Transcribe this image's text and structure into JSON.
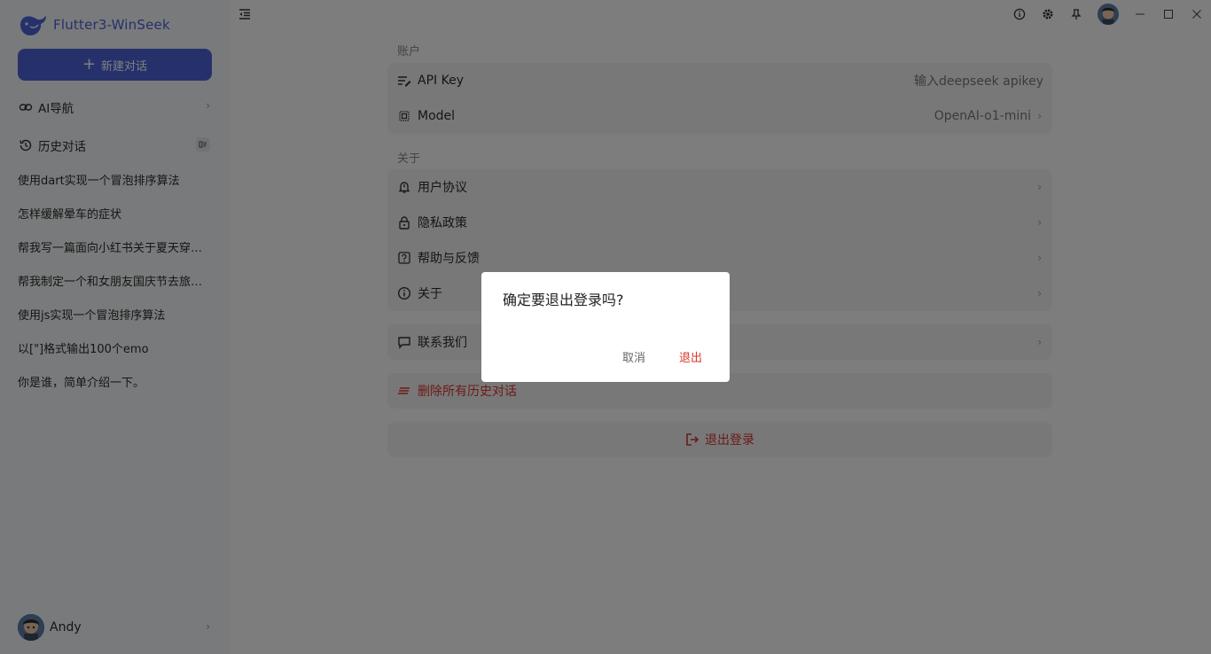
{
  "app": {
    "title": "Flutter3-WinSeek"
  },
  "sidebar": {
    "new_chat_label": "新建对话",
    "nav_ai": "AI导航",
    "nav_history": "历史对话",
    "history": [
      "使用dart实现一个冒泡排序算法",
      "怎样缓解晕车的症状",
      "帮我写一篇面向小红书关于夏天穿搭的文案",
      "帮我制定一个和女朋友国庆节去旅游的攻略",
      "使用js实现一个冒泡排序算法",
      "以[\"]格式输出100个emo",
      "你是谁，简单介绍一下。"
    ],
    "user_name": "Andy"
  },
  "settings": {
    "account_title": "账户",
    "api_key_label": "API Key",
    "api_key_placeholder": "输入deepseek apikey",
    "model_label": "Model",
    "model_value": "OpenAI-o1-mini",
    "about_title": "关于",
    "user_agreement": "用户协议",
    "privacy_policy": "隐私政策",
    "help_feedback": "帮助与反馈",
    "about": "关于",
    "contact_us": "联系我们",
    "delete_history": "删除所有历史对话",
    "logout": "退出登录"
  },
  "dialog": {
    "message": "确定要退出登录吗?",
    "cancel_label": "取消",
    "confirm_label": "退出"
  },
  "colors": {
    "accent": "#4c63d8",
    "danger": "#d9362b"
  }
}
